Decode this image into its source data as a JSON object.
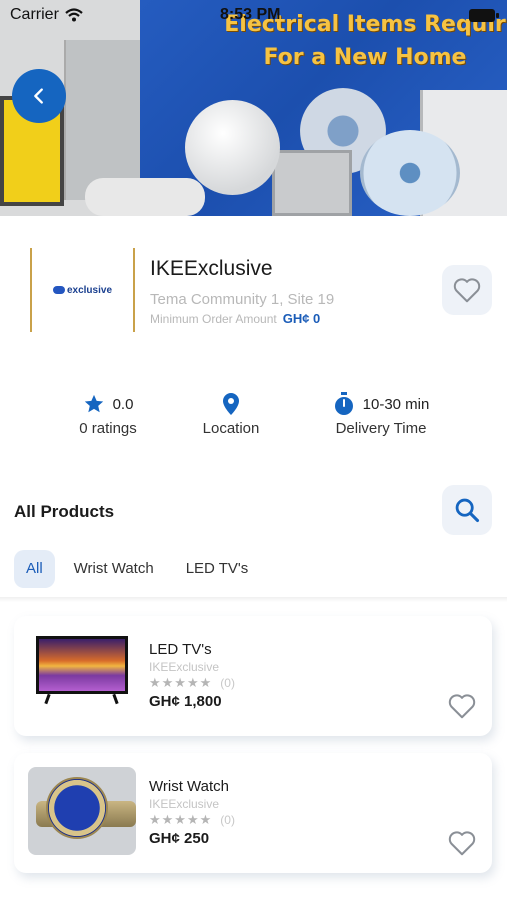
{
  "status_bar": {
    "carrier": "Carrier",
    "time": "8:53 PM"
  },
  "banner": {
    "headline_line1": "Electrical Items Requir",
    "headline_line2": "For a New Home"
  },
  "store": {
    "logo_text": "exclusive",
    "name": "IKEExclusive",
    "address": "Tema Community 1, Site 19",
    "min_order_label": "Minimum Order Amount",
    "min_order_value": "GH¢ 0"
  },
  "stats": {
    "rating_value": "0.0",
    "rating_label": "0 ratings",
    "location_label": "Location",
    "delivery_value": "10-30 min",
    "delivery_label": "Delivery Time"
  },
  "products_section": {
    "title": "All Products",
    "tabs": [
      {
        "label": "All",
        "active": true
      },
      {
        "label": "Wrist Watch",
        "active": false
      },
      {
        "label": "LED TV's",
        "active": false
      }
    ]
  },
  "products": [
    {
      "name": "LED TV's",
      "shop": "IKEExclusive",
      "stars": "★★★★★",
      "review_count": "(0)",
      "price": "GH¢ 1,800"
    },
    {
      "name": "Wrist Watch",
      "shop": "IKEExclusive",
      "stars": "★★★★★",
      "review_count": "(0)",
      "price": "GH¢ 250"
    }
  ],
  "colors": {
    "accent": "#1565c0",
    "price_accent": "#1a5cb8",
    "tab_active_bg": "#e4ecf7",
    "icon_button_bg": "#eef2f8"
  }
}
